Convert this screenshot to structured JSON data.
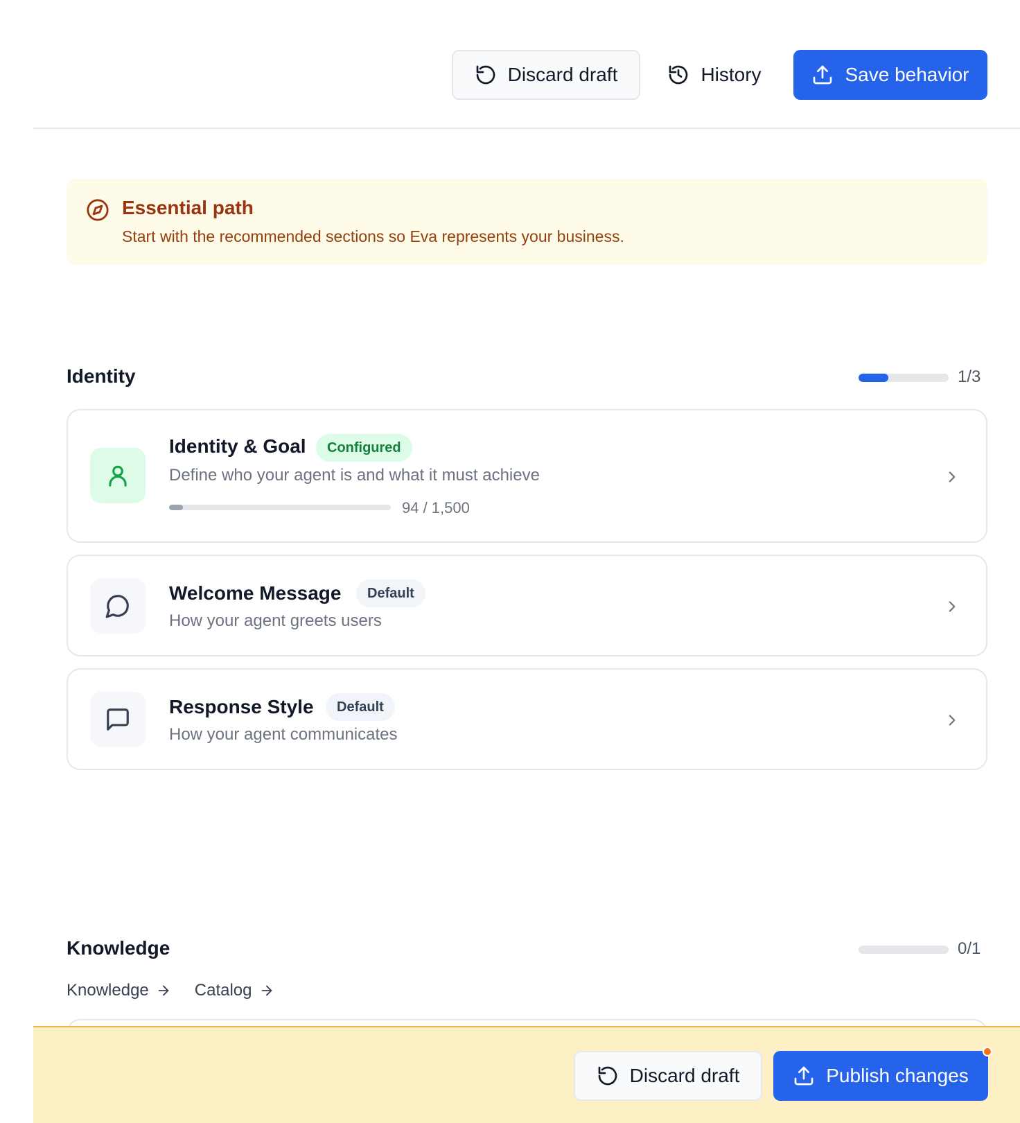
{
  "toolbar": {
    "discard_label": "Discard draft",
    "history_label": "History",
    "save_label": "Save behavior"
  },
  "banner": {
    "title": "Essential path",
    "text": "Start with the recommended sections so Eva represents your business."
  },
  "sections": {
    "identity": {
      "title": "Identity",
      "count": "1/3",
      "progress": 0.33,
      "cards": [
        {
          "title": "Identity & Goal",
          "badge": "Configured",
          "description": "Define who your agent is and what it must achieve",
          "char_count": "94 / 1,500",
          "char_progress": 0.0627,
          "icon": "user-icon"
        },
        {
          "title": "Welcome Message",
          "badge": "Default",
          "description": "How your agent greets users",
          "icon": "chat-bubble-icon"
        },
        {
          "title": "Response Style",
          "badge": "Default",
          "description": "How your agent communicates",
          "icon": "message-square-icon"
        }
      ]
    },
    "knowledge": {
      "title": "Knowledge",
      "count": "0/1",
      "progress": 0,
      "links": [
        {
          "label": "Knowledge"
        },
        {
          "label": "Catalog"
        }
      ]
    }
  },
  "publish_bar": {
    "discard_label": "Discard draft",
    "publish_label": "Publish changes"
  },
  "colors": {
    "primary": "#2563eb",
    "banner_bg": "#fefbe8",
    "banner_text": "#9a3412",
    "configured_badge": "#dcfce7",
    "publish_bar_bg": "#fdf0c4",
    "notification_dot": "#f97316"
  }
}
